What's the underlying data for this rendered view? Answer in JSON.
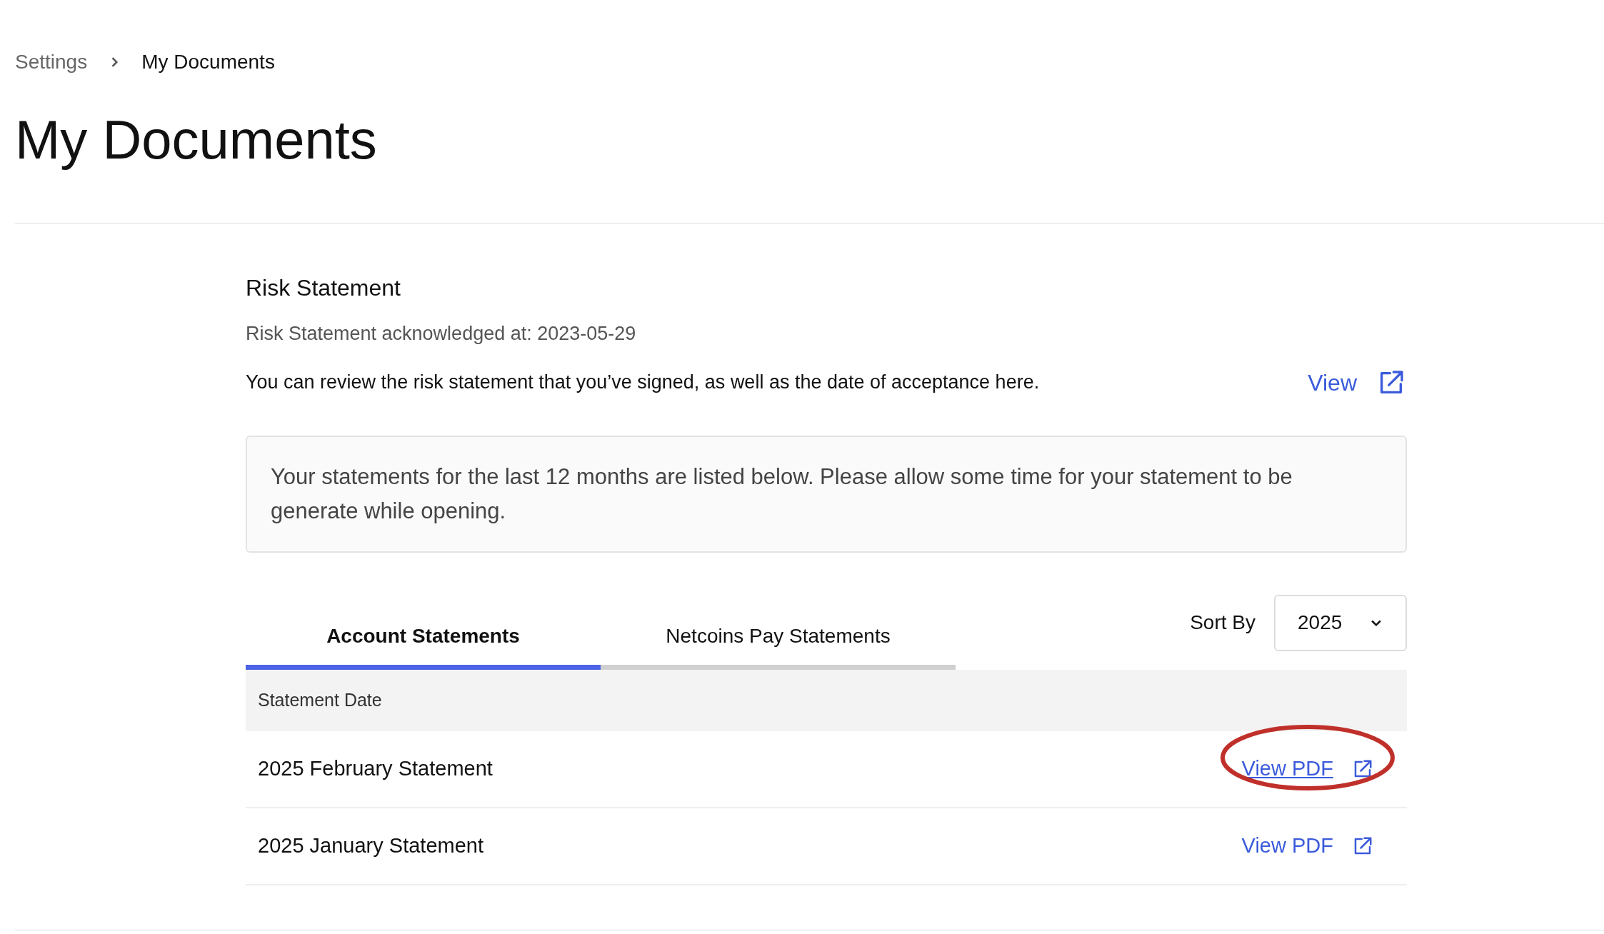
{
  "breadcrumb": [
    {
      "label": "Settings",
      "current": false
    },
    {
      "label": "My Documents",
      "current": true
    }
  ],
  "title": "My Documents",
  "risk": {
    "heading": "Risk Statement",
    "acknowledged": "Risk Statement acknowledged at: 2023-05-29",
    "description": "You can review the risk statement that you’ve signed, as well as the date of acceptance here.",
    "link": "View"
  },
  "notice": "Your statements for the last 12 months are listed below. Please allow some time for your statement to be generate while opening.",
  "tabs": [
    {
      "label": "Account Statements",
      "selected": true
    },
    {
      "label": "Netcoins Pay Statements",
      "selected": false
    }
  ],
  "sort": {
    "label": "Sort By",
    "value": "2025"
  },
  "table": {
    "columns": [
      "Statement Date"
    ],
    "rows": [
      {
        "name": "2025 February Statement",
        "link": "View PDF",
        "highlighted": true
      },
      {
        "name": "2025 January Statement",
        "link": "View PDF",
        "highlighted": false
      }
    ]
  }
}
